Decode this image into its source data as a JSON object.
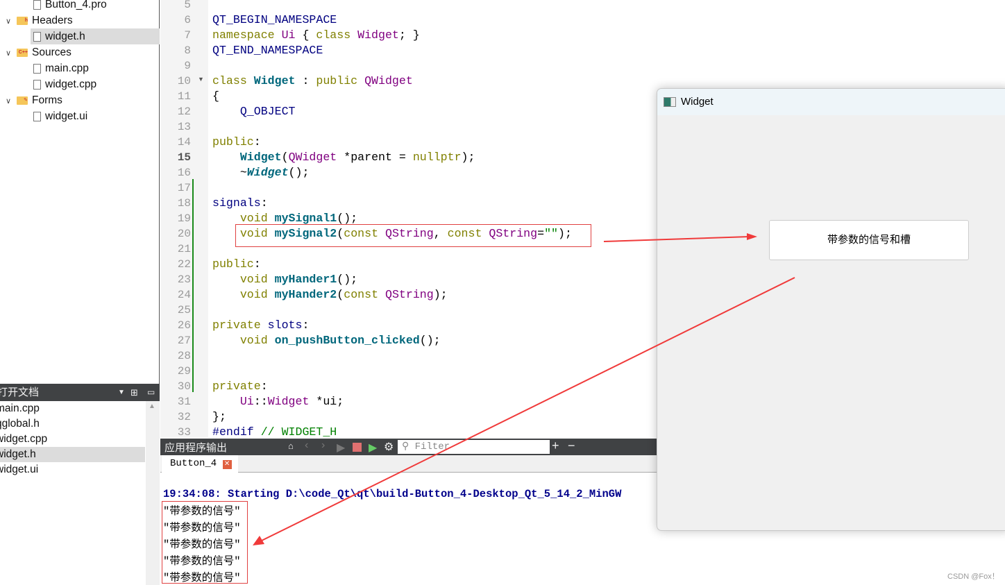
{
  "project_tree": [
    {
      "label": "Button_4.pro",
      "indent": 1,
      "type": "pro"
    },
    {
      "label": "Headers",
      "indent": 0,
      "type": "folder",
      "folder_mark": "h",
      "expanded": true
    },
    {
      "label": "widget.h",
      "indent": 1,
      "type": "header",
      "selected": true
    },
    {
      "label": "Sources",
      "indent": 0,
      "type": "folder",
      "folder_mark": "C++",
      "expanded": true
    },
    {
      "label": "main.cpp",
      "indent": 1,
      "type": "file"
    },
    {
      "label": "widget.cpp",
      "indent": 1,
      "type": "file"
    },
    {
      "label": "Forms",
      "indent": 0,
      "type": "folder",
      "folder_mark": "✎",
      "expanded": true
    },
    {
      "label": "widget.ui",
      "indent": 1,
      "type": "form"
    }
  ],
  "open_docs": {
    "title": "打开文档",
    "items": [
      "main.cpp",
      "qglobal.h",
      "widget.cpp",
      "widget.h",
      "widget.ui"
    ],
    "selected": "widget.h"
  },
  "editor": {
    "first_line": 5,
    "current_line": 15,
    "lines": [
      [],
      [
        [
          "mac",
          "QT_BEGIN_NAMESPACE"
        ]
      ],
      [
        [
          "kw",
          "namespace "
        ],
        [
          "ty",
          "Ui"
        ],
        [
          "df",
          " { "
        ],
        [
          "kw",
          "class "
        ],
        [
          "ty",
          "Widget"
        ],
        [
          "df",
          "; }"
        ]
      ],
      [
        [
          "mac",
          "QT_END_NAMESPACE"
        ]
      ],
      [],
      [
        [
          "kw",
          "class "
        ],
        [
          "fn",
          "Widget"
        ],
        [
          "df",
          " : "
        ],
        [
          "kw",
          "public "
        ],
        [
          "ty",
          "QWidget"
        ]
      ],
      [
        [
          "df",
          "{"
        ]
      ],
      [
        [
          "mac",
          "    Q_OBJECT"
        ]
      ],
      [],
      [
        [
          "kw",
          "public"
        ],
        [
          "df",
          ":"
        ]
      ],
      [
        [
          "df",
          "    "
        ],
        [
          "fn",
          "Widget"
        ],
        [
          "df",
          "("
        ],
        [
          "ty",
          "QWidget"
        ],
        [
          "df",
          " *parent = "
        ],
        [
          "kw",
          "nullptr"
        ],
        [
          "df",
          ");"
        ]
      ],
      [
        [
          "df",
          "    ~"
        ],
        [
          "fi",
          "Widget"
        ],
        [
          "df",
          "();"
        ]
      ],
      [],
      [
        [
          "mac",
          "signals"
        ],
        [
          "df",
          ":"
        ]
      ],
      [
        [
          "df",
          "    "
        ],
        [
          "kw",
          "void "
        ],
        [
          "fn",
          "mySignal1"
        ],
        [
          "df",
          "();"
        ]
      ],
      [
        [
          "df",
          "    "
        ],
        [
          "kw",
          "void "
        ],
        [
          "fn",
          "mySignal2"
        ],
        [
          "df",
          "("
        ],
        [
          "kw",
          "const "
        ],
        [
          "ty",
          "QString"
        ],
        [
          "df",
          ", "
        ],
        [
          "kw",
          "const "
        ],
        [
          "ty",
          "QString"
        ],
        [
          "df",
          "="
        ],
        [
          "st",
          "\"\""
        ],
        [
          "df",
          ");"
        ]
      ],
      [],
      [
        [
          "kw",
          "public"
        ],
        [
          "df",
          ":"
        ]
      ],
      [
        [
          "df",
          "    "
        ],
        [
          "kw",
          "void "
        ],
        [
          "fn",
          "myHander1"
        ],
        [
          "df",
          "();"
        ]
      ],
      [
        [
          "df",
          "    "
        ],
        [
          "kw",
          "void "
        ],
        [
          "fn",
          "myHander2"
        ],
        [
          "df",
          "("
        ],
        [
          "kw",
          "const "
        ],
        [
          "ty",
          "QString"
        ],
        [
          "df",
          ");"
        ]
      ],
      [],
      [
        [
          "kw",
          "private "
        ],
        [
          "mac",
          "slots"
        ],
        [
          "df",
          ":"
        ]
      ],
      [
        [
          "df",
          "    "
        ],
        [
          "kw",
          "void "
        ],
        [
          "fn",
          "on_pushButton_clicked"
        ],
        [
          "df",
          "();"
        ]
      ],
      [],
      [],
      [
        [
          "kw",
          "private"
        ],
        [
          "df",
          ":"
        ]
      ],
      [
        [
          "df",
          "    "
        ],
        [
          "ty",
          "Ui"
        ],
        [
          "df",
          "::"
        ],
        [
          "ty",
          "Widget"
        ],
        [
          "df",
          " *ui;"
        ]
      ],
      [
        [
          "df",
          "};"
        ]
      ],
      [
        [
          "pp",
          "#endif "
        ],
        [
          "cm",
          "// WIDGET_H"
        ]
      ]
    ]
  },
  "output": {
    "title": "应用程序输出",
    "filter_placeholder": "Filter",
    "tab": "Button_4",
    "start_line": "19:34:08: Starting D:\\code_Qt\\qt\\build-Button_4-Desktop_Qt_5_14_2_MinGW",
    "lines": [
      "\"带参数的信号\"",
      "\"带参数的信号\"",
      "\"带参数的信号\"",
      "\"带参数的信号\"",
      "\"带参数的信号\""
    ]
  },
  "widget_window": {
    "title": "Widget",
    "button_label": "带参数的信号和槽"
  },
  "watermark": "CSDN @Fox！",
  "colors": {
    "annotation": "#f03a3a",
    "dark_bar": "#404244",
    "start_text": "#00008b"
  }
}
